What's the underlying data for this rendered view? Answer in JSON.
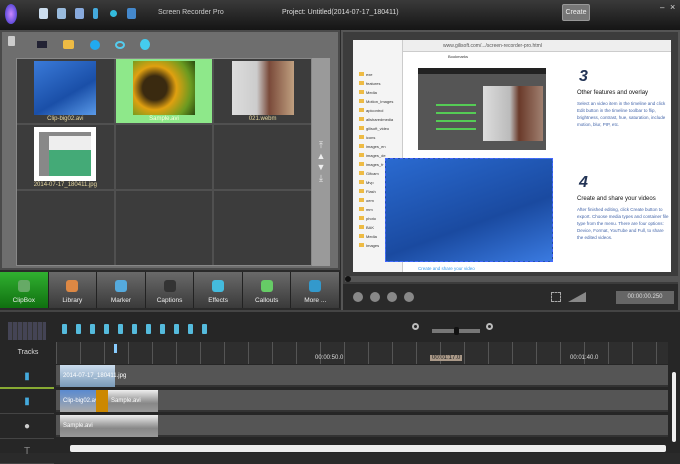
{
  "titlebar": {
    "app_name": "Screen Recorder Pro",
    "project": "Project: Untitled(2014-07-17_180411)",
    "create_label": "Create",
    "close": "×",
    "minimize": "–"
  },
  "library": {
    "items": [
      {
        "label": "Clip-big02.avi",
        "selected": false
      },
      {
        "label": "Sample.avi",
        "selected": true
      },
      {
        "label": "021.webm",
        "selected": false
      },
      {
        "label": "2014-07-17_180411.jpg",
        "selected": false
      }
    ],
    "scroll_arrows": [
      "⤒",
      "▲",
      "▼",
      "⤓"
    ]
  },
  "toolbar_buttons": [
    {
      "label": "ClipBox",
      "active": true,
      "color": "#6a6"
    },
    {
      "label": "Library",
      "active": false,
      "color": "#d84"
    },
    {
      "label": "Marker",
      "active": false,
      "color": "#5ad"
    },
    {
      "label": "Captions",
      "active": false,
      "color": "#333"
    },
    {
      "label": "Effects",
      "active": false,
      "color": "#4bd"
    },
    {
      "label": "Callouts",
      "active": false,
      "color": "#6c6"
    },
    {
      "label": "More ...",
      "active": false,
      "color": "#39c"
    }
  ],
  "preview": {
    "url": "www.gilisoft.com/.../screen-recorder-pro.html",
    "bookmarks": "Bookmarks",
    "tree": [
      "exe",
      "features",
      "Media",
      "Motion_Images",
      "apicontrol",
      "allsharedmedia",
      "gilisoft_video",
      "icons",
      "images_en",
      "images_de",
      "images_fr",
      "Gifcam",
      "Mvp",
      "Flash",
      "oem",
      "mm",
      "photo",
      "BAK",
      "Media",
      "Images"
    ],
    "step3_num": "3",
    "step3_title": "Other features and overlay",
    "step3_text": "Select an video item in the timeline and click Edit button in the timeline toolbar to flip, brightness, contrast, hue, saturation, include motion, blur, PIP, etc.",
    "step4_num": "4",
    "step4_title": "Create and share your videos",
    "step4_text": "After finished editing, click Create button to export. Choose media types and container file type from the menu. There are four options: Device, Format, YouTube and Full, to share the edited videos.",
    "link": "Create and share your video",
    "time": "00:00:00.250"
  },
  "timeline": {
    "tracks_label": "Tracks",
    "ruler": [
      "00:00:50.0",
      "00:01:17.0",
      "00:01:40.0"
    ],
    "clips": {
      "track1": "2014-07-17_180411.jpg",
      "track2a": "Clip-big02.avi",
      "track2b": "Sample.avi",
      "track3": "Sample.avi"
    }
  }
}
